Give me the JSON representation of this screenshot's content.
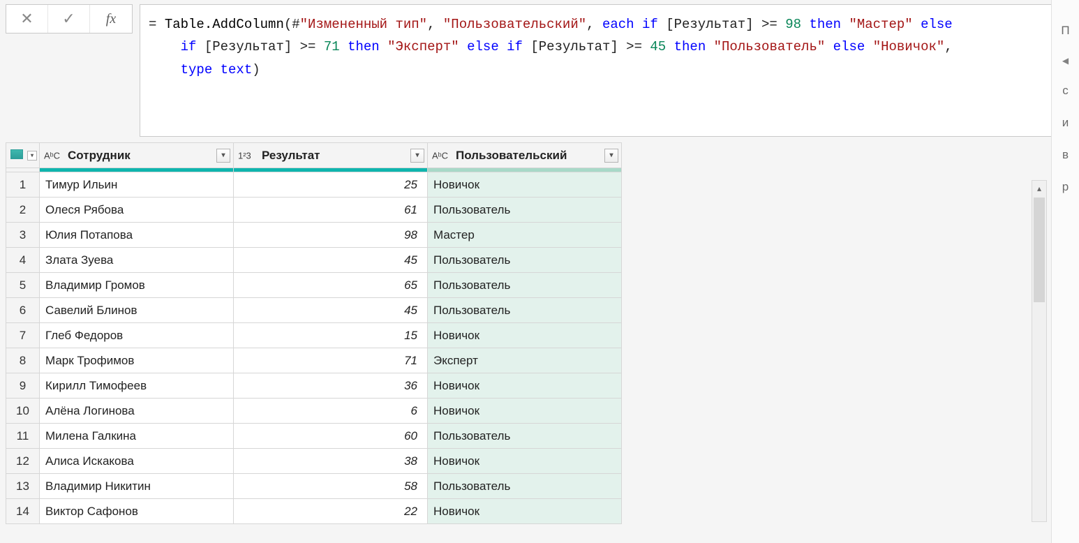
{
  "toolbar": {
    "cancel_glyph": "✕",
    "accept_glyph": "✓",
    "fx_label": "fx"
  },
  "formula": {
    "prefix": "= ",
    "fn": "Table.AddColumn",
    "tokens": {
      "open": "(",
      "hash": "#",
      "source": "\"Измененный тип\"",
      "comma1": ", ",
      "newcol": "\"Пользовательский\"",
      "comma2": ", ",
      "each": "each",
      "if1": "if",
      "col": "[Результат]",
      "ge": " >= ",
      "v98": "98",
      "then1": "then",
      "s_master": "\"Мастер\"",
      "else1": "else",
      "v71": "71",
      "s_expert": "\"Эксперт\"",
      "v45": "45",
      "s_user": "\"Пользователь\"",
      "s_novice": "\"Новичок\"",
      "type": "type",
      "text": "text",
      "close": ")"
    }
  },
  "columns": {
    "employee": "Сотрудник",
    "result": "Результат",
    "custom": "Пользовательский"
  },
  "type_icons": {
    "abc": "AᵇC",
    "num": "1²3"
  },
  "rows": [
    {
      "n": "1",
      "employee": "Тимур Ильин",
      "result": "25",
      "custom": "Новичок"
    },
    {
      "n": "2",
      "employee": "Олеся Рябова",
      "result": "61",
      "custom": "Пользователь"
    },
    {
      "n": "3",
      "employee": "Юлия Потапова",
      "result": "98",
      "custom": "Мастер"
    },
    {
      "n": "4",
      "employee": "Злата Зуева",
      "result": "45",
      "custom": "Пользователь"
    },
    {
      "n": "5",
      "employee": "Владимир Громов",
      "result": "65",
      "custom": "Пользователь"
    },
    {
      "n": "6",
      "employee": "Савелий Блинов",
      "result": "45",
      "custom": "Пользователь"
    },
    {
      "n": "7",
      "employee": "Глеб Федоров",
      "result": "15",
      "custom": "Новичок"
    },
    {
      "n": "8",
      "employee": "Марк Трофимов",
      "result": "71",
      "custom": "Эксперт"
    },
    {
      "n": "9",
      "employee": "Кирилл Тимофеев",
      "result": "36",
      "custom": "Новичок"
    },
    {
      "n": "10",
      "employee": "Алёна Логинова",
      "result": "6",
      "custom": "Новичок"
    },
    {
      "n": "11",
      "employee": "Милена Галкина",
      "result": "60",
      "custom": "Пользователь"
    },
    {
      "n": "12",
      "employee": "Алиса Искакова",
      "result": "38",
      "custom": "Новичок"
    },
    {
      "n": "13",
      "employee": "Владимир Никитин",
      "result": "58",
      "custom": "Пользователь"
    },
    {
      "n": "14",
      "employee": "Виктор Сафонов",
      "result": "22",
      "custom": "Новичок"
    }
  ],
  "side": {
    "letters": [
      "П",
      "с",
      "и",
      "в",
      "р"
    ]
  }
}
